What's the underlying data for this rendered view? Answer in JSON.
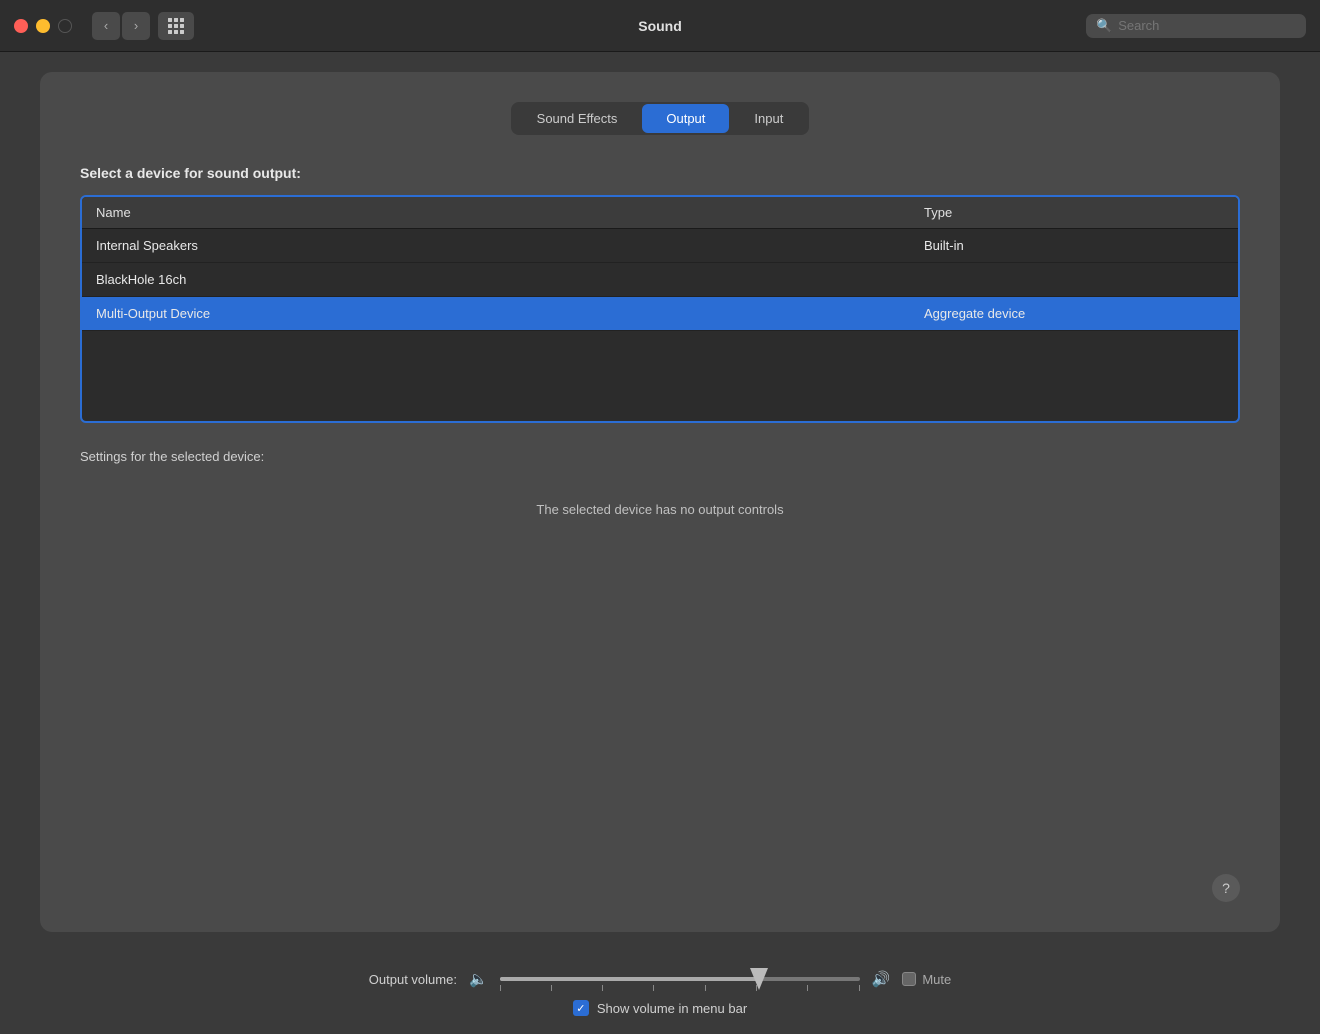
{
  "titlebar": {
    "title": "Sound",
    "search_placeholder": "Search"
  },
  "tabs": {
    "items": [
      {
        "id": "sound-effects",
        "label": "Sound Effects",
        "active": false
      },
      {
        "id": "output",
        "label": "Output",
        "active": true
      },
      {
        "id": "input",
        "label": "Input",
        "active": false
      }
    ]
  },
  "main": {
    "section_label": "Select a device for sound output:",
    "table": {
      "headers": {
        "name": "Name",
        "type": "Type"
      },
      "rows": [
        {
          "name": "Internal Speakers",
          "type": "Built-in",
          "selected": false
        },
        {
          "name": "BlackHole 16ch",
          "type": "",
          "selected": false
        },
        {
          "name": "Multi-Output Device",
          "type": "Aggregate device",
          "selected": true
        }
      ]
    },
    "settings_label": "Settings for the selected device:",
    "no_controls_text": "The selected device has no output controls",
    "help_label": "?"
  },
  "bottom": {
    "volume_label": "Output volume:",
    "mute_label": "Mute",
    "show_volume_label": "Show volume in menu bar",
    "show_volume_checked": true
  }
}
